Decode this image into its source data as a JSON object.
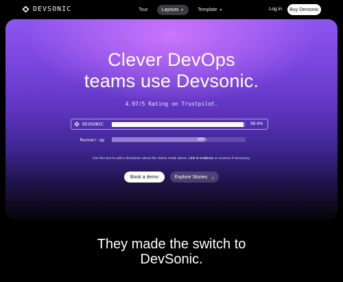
{
  "nav": {
    "brand": "DEVSONIC",
    "menu": [
      {
        "label": "Tour"
      },
      {
        "label": "Layouts"
      },
      {
        "label": "Template"
      }
    ],
    "login": "Log in",
    "buy": "Buy Devsonic"
  },
  "hero": {
    "title_line1": "Clever DevOps",
    "title_line2": "teams use Devsonic.",
    "rating": "4.97/5 Rating on Trustpilot.",
    "comparison": [
      {
        "label": "DEVSONIC",
        "value_text": "98.4%",
        "value": 0.984
      },
      {
        "label": "Runner-up",
        "value_text": "69%",
        "value": 0.69
      }
    ],
    "disclaimer_pre": "Use this text to add a disclaimer about the claims made above. ",
    "disclaimer_link1": "Link to evidence",
    "disclaimer_mid": " or sources if necessary.",
    "primary_button": "Book a demo",
    "secondary_button": "Explore Stories"
  },
  "section": {
    "title_line1": "They made the switch to",
    "title_line2": "DevSonic."
  },
  "icons": {
    "logo": "devsonic-logo-icon",
    "caret": "chevron-down-icon",
    "arrow": "arrow-down-icon"
  }
}
